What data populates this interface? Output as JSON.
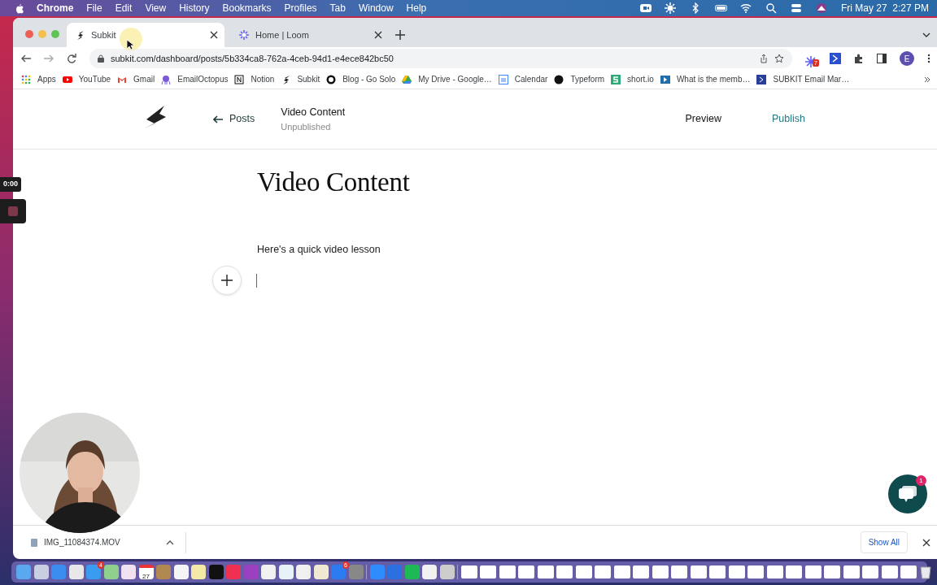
{
  "menu_bar": {
    "app": "Chrome",
    "items": [
      "File",
      "Edit",
      "View",
      "History",
      "Bookmarks",
      "Profiles",
      "Tab",
      "Window",
      "Help"
    ],
    "clock": "Fri May 27  2:27 PM"
  },
  "tabs": [
    {
      "title": "Subkit",
      "selected": true
    },
    {
      "title": "Home | Loom",
      "selected": false
    }
  ],
  "address_bar": {
    "url": "subkit.com/dashboard/posts/5b334ca8-762a-4ceb-94d1-e4ece842bc50"
  },
  "extensions": {
    "badge": "7",
    "profile_initial": "E"
  },
  "bookmarks": [
    "Apps",
    "YouTube",
    "Gmail",
    "EmailOctopus",
    "Notion",
    "Subkit",
    "Blog - Go Solo",
    "My Drive - Google…",
    "Calendar",
    "Typeform",
    "short.io",
    "What is the memb…",
    "SUBKIT Email Mar…"
  ],
  "recorder": {
    "time": "0:00"
  },
  "post_header": {
    "back": "Posts",
    "title": "Video Content",
    "status": "Unpublished",
    "preview": "Preview",
    "publish": "Publish"
  },
  "editor": {
    "title": "Video Content",
    "paragraph": "Here's a quick video lesson"
  },
  "chat": {
    "badge": "1"
  },
  "download_bar": {
    "file": "IMG_11084374.MOV",
    "show_all": "Show All"
  },
  "dock": {
    "mail_badge": "4",
    "calendar_day": "27",
    "app_store_badge": "6"
  }
}
